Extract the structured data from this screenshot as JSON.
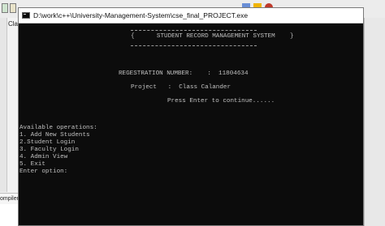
{
  "background": {
    "left_panel_label": "Class",
    "compiler_tab_label": "ompiler"
  },
  "window": {
    "title": "D:\\work\\c++\\University-Management-System\\cse_final_PROJECT.exe"
  },
  "console": {
    "banner_title": "{      STUDENT RECORD MANAGEMENT SYSTEM    }",
    "registration_line": "REGESTRATION NUMBER:    :  11804634",
    "project_line": "Project   :  Class Calander",
    "press_enter": "Press Enter to continue......",
    "operations_header": "Available operations:",
    "options": [
      "1. Add New Students",
      "2.Student Login",
      "3. Faculty Login",
      "4. Admin View",
      "5. Exit"
    ],
    "prompt": "Enter option:"
  }
}
